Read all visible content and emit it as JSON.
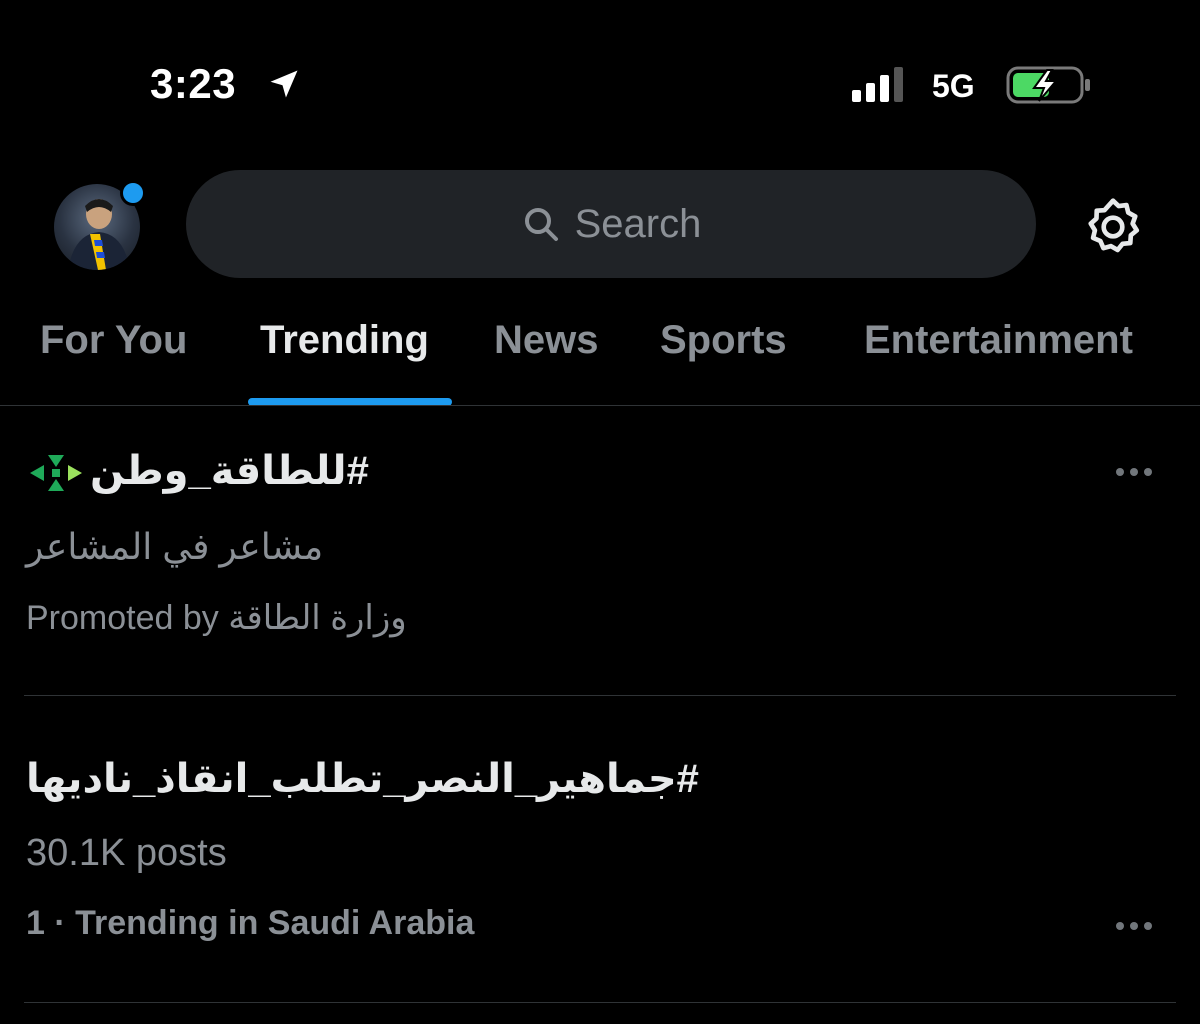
{
  "status_bar": {
    "time": "3:23",
    "network": "5G",
    "icons": [
      "location-arrow-icon",
      "signal-icon",
      "battery-charging-icon"
    ]
  },
  "header": {
    "search_placeholder": "Search",
    "icons": [
      "search-icon",
      "gear-icon"
    ]
  },
  "tabs": [
    {
      "label": "For You"
    },
    {
      "label": "Trending",
      "active": true
    },
    {
      "label": "News"
    },
    {
      "label": "Sports"
    },
    {
      "label": "Entertainment"
    }
  ],
  "trends": [
    {
      "title": "#للطاقة_وطن",
      "subtitle": "مشاعر في المشاعر",
      "promoted_by": "Promoted by",
      "promoter": "وزارة الطاقة"
    },
    {
      "title": "#جماهير_النصر_تطلب_انقاذ_ناديها",
      "posts": "30.1K posts",
      "context": "1 · Trending in Saudi Arabia"
    }
  ],
  "colors": {
    "accent": "#1d9bf0",
    "background": "#000000",
    "muted_text": "#8b9096",
    "battery_green": "#4cd964"
  }
}
